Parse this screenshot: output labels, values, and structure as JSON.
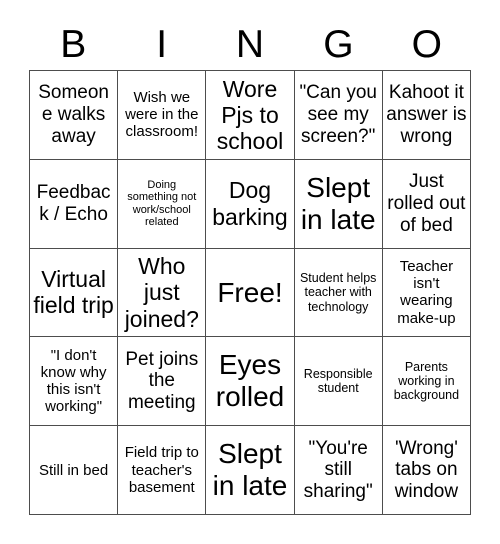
{
  "card": {
    "title_letters": [
      "B",
      "I",
      "N",
      "G",
      "O"
    ],
    "free_space_label": "Free!",
    "colors": {
      "background": "#ffffff",
      "text": "#000000",
      "grid_line": "#4d4d4d"
    },
    "grid": {
      "columns": 5,
      "rows": 5,
      "cells": [
        {
          "text": "Someone walks away",
          "size": "md"
        },
        {
          "text": "Wish we were in the classroom!",
          "size": "sm"
        },
        {
          "text": "Wore Pjs to school",
          "size": "lg"
        },
        {
          "text": "\"Can you see my screen?\"",
          "size": "md"
        },
        {
          "text": "Kahoot it answer is wrong",
          "size": "md"
        },
        {
          "text": "Feedback / Echo",
          "size": "md"
        },
        {
          "text": "Doing something not work/school related",
          "size": "xxs"
        },
        {
          "text": "Dog barking",
          "size": "lg"
        },
        {
          "text": "Slept in late",
          "size": "xl"
        },
        {
          "text": "Just rolled out of bed",
          "size": "md"
        },
        {
          "text": "Virtual field trip",
          "size": "lg"
        },
        {
          "text": "Who just joined?",
          "size": "lg"
        },
        {
          "text": "Free!",
          "size": "xl"
        },
        {
          "text": "Student helps teacher with technology",
          "size": "xs"
        },
        {
          "text": "Teacher isn't wearing make-up",
          "size": "sm"
        },
        {
          "text": "\"I don't know why this isn't working\"",
          "size": "sm"
        },
        {
          "text": "Pet joins the meeting",
          "size": "md"
        },
        {
          "text": "Eyes rolled",
          "size": "xl"
        },
        {
          "text": "Responsible student",
          "size": "xs"
        },
        {
          "text": "Parents working in background",
          "size": "xs"
        },
        {
          "text": "Still in bed",
          "size": "sm"
        },
        {
          "text": "Field trip to teacher's basement",
          "size": "sm"
        },
        {
          "text": "Slept in late",
          "size": "xl"
        },
        {
          "text": "\"You're still sharing\"",
          "size": "md"
        },
        {
          "text": "'Wrong' tabs on window",
          "size": "md"
        }
      ]
    }
  }
}
